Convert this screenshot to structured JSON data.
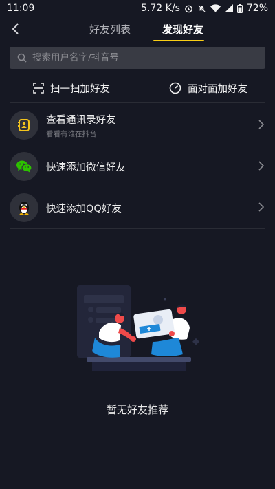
{
  "status_bar": {
    "time": "11:09",
    "network_speed": "5.72 K/s",
    "battery": "72%"
  },
  "header": {
    "tabs": [
      {
        "label": "好友列表"
      },
      {
        "label": "发现好友"
      }
    ],
    "active_tab": 1
  },
  "search": {
    "placeholder": "搜索用户名字/抖音号"
  },
  "quick_actions": [
    {
      "label": "扫一扫加好友"
    },
    {
      "label": "面对面加好友"
    }
  ],
  "list": [
    {
      "title": "查看通讯录好友",
      "subtitle": "看看有谁在抖音",
      "icon": "contacts-icon"
    },
    {
      "title": "快速添加微信好友",
      "icon": "wechat-icon"
    },
    {
      "title": "快速添加QQ好友",
      "icon": "qq-penguin-icon"
    }
  ],
  "empty_state": {
    "text": "暂无好友推荐"
  },
  "colors": {
    "background": "#161823",
    "accent": "#face15",
    "wechat": "#2dc100",
    "search_bg": "#393b44"
  }
}
